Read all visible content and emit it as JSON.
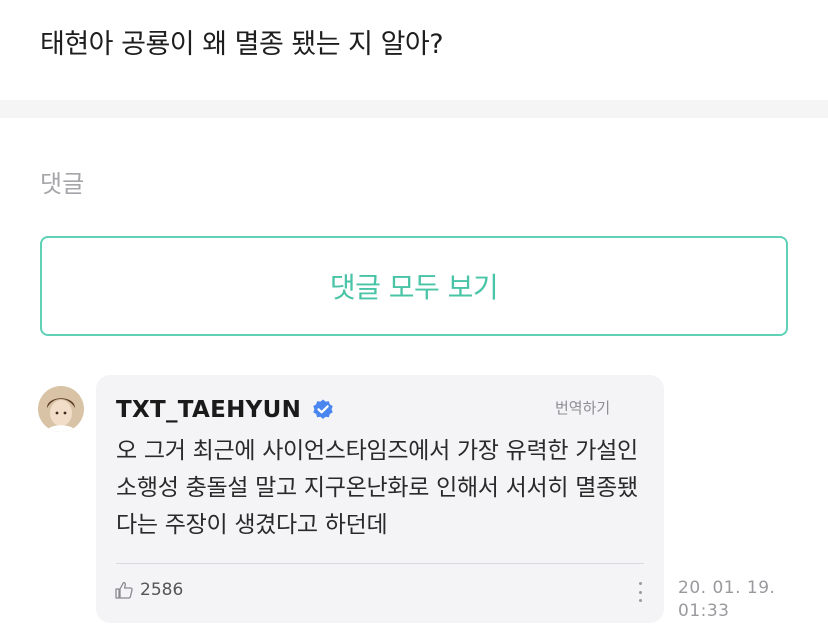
{
  "post": {
    "text": "태현아 공룡이 왜 멸종 됐는 지 알아?"
  },
  "comments_section": {
    "label": "댓글",
    "view_all_label": "댓글 모두 보기"
  },
  "reply": {
    "author": "TXT_TAEHYUN",
    "verified_icon": "verified-badge-icon",
    "translate_label": "번역하기",
    "text": "오 그거 최근에 사이언스타임즈에서 가장 유력한 가설인 소행성 충돌설 말고 지구온난화로 인해서 서서히 멸종됐다는 주장이 생겼다고 하던데",
    "like_icon": "thumbs-up-icon",
    "likes": "2586",
    "more_icon": "more-vertical-icon",
    "date": "20. 01. 19.",
    "time": "01:33"
  },
  "colors": {
    "accent": "#49c4a6",
    "accent_border": "#5fd1b6",
    "verified": "#4a86f0",
    "bubble_bg": "#f4f4f6",
    "band_bg": "#f5f5f6"
  }
}
